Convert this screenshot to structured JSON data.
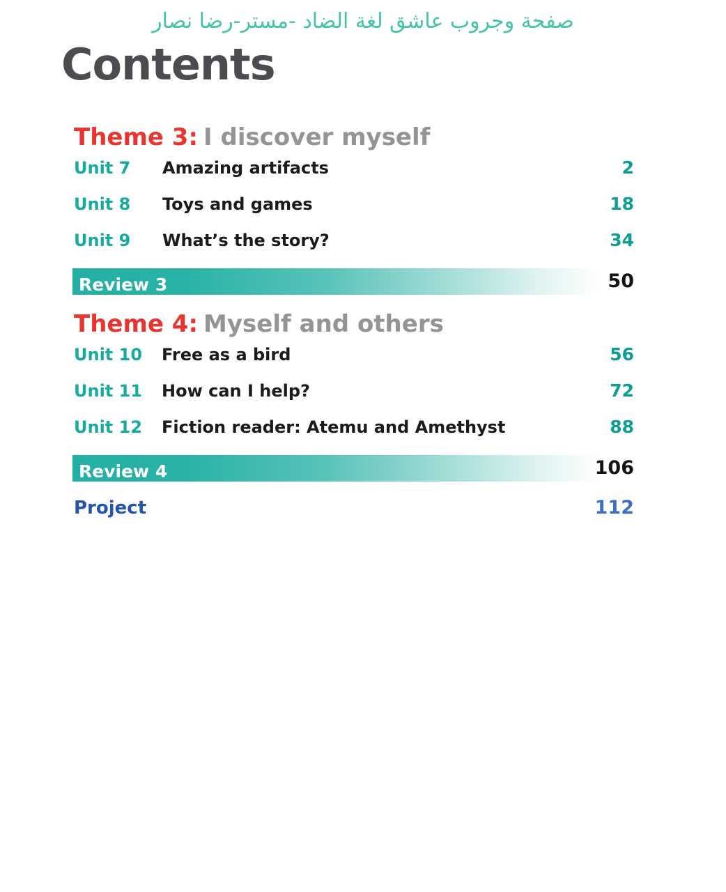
{
  "watermark": {
    "text": "صفحة وجروب عاشق لغة الضاد -مستر-رضا نصار",
    "color": "#45c3a8"
  },
  "page_title": "Contents",
  "colors": {
    "title_grey": "#4c4c50",
    "theme_red": "#e8352f",
    "theme_name_grey": "#949497",
    "unit_teal": "#17ab9f",
    "page_num_teal": "#0e9c93",
    "review_bar_teal": "#23b0a4",
    "review_page_dark": "#141414",
    "project_blue": "#2455a8",
    "project_page_blue": "#3a6fc4",
    "body_text": "#1b1b1b",
    "background": "#ffffff"
  },
  "themes": [
    {
      "label": "Theme 3:",
      "name": "I discover myself",
      "units": [
        {
          "unit": "Unit 7",
          "title": "Amazing artifacts",
          "page": "2"
        },
        {
          "unit": "Unit 8",
          "title": "Toys and games",
          "page": "18"
        },
        {
          "unit": "Unit 9",
          "title": "What’s the story?",
          "page": "34"
        }
      ],
      "review": {
        "label": "Review 3",
        "page": "50"
      }
    },
    {
      "label": "Theme 4:",
      "name": "Myself and others",
      "units": [
        {
          "unit": "Unit 10",
          "title": "Free as a bird",
          "page": "56"
        },
        {
          "unit": "Unit 11",
          "title": "How can I help?",
          "page": "72"
        },
        {
          "unit": "Unit 12",
          "title": "Fiction reader: Atemu and Amethyst",
          "page": "88"
        }
      ],
      "review": {
        "label": "Review 4",
        "page": "106"
      }
    }
  ],
  "project": {
    "label": "Project",
    "page": "112"
  }
}
